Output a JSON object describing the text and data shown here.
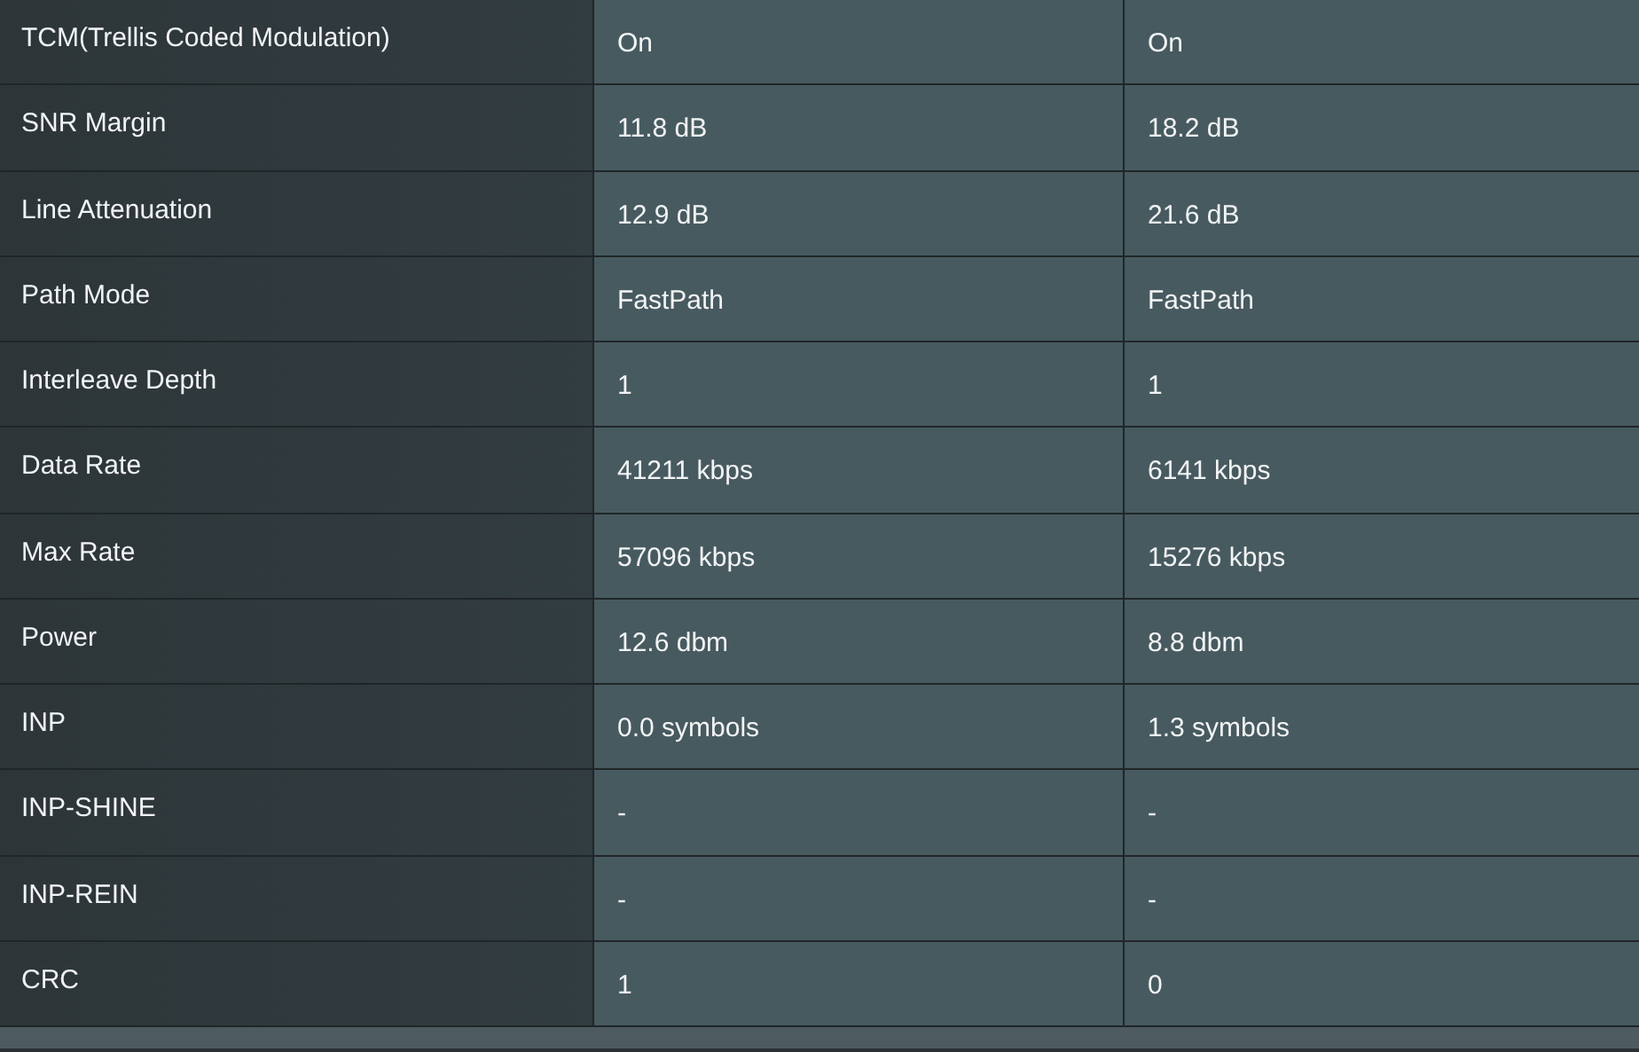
{
  "rows": [
    {
      "label": "TCM(Trellis Coded Modulation)",
      "values": [
        "On",
        "On"
      ]
    },
    {
      "label": "SNR Margin",
      "values": [
        "11.8 dB",
        "18.2 dB"
      ]
    },
    {
      "label": "Line Attenuation",
      "values": [
        "12.9 dB",
        "21.6 dB"
      ]
    },
    {
      "label": "Path Mode",
      "values": [
        "FastPath",
        "FastPath"
      ]
    },
    {
      "label": "Interleave Depth",
      "values": [
        "1",
        "1"
      ]
    },
    {
      "label": "Data Rate",
      "values": [
        "41211 kbps",
        "6141 kbps"
      ]
    },
    {
      "label": "Max Rate",
      "values": [
        "57096 kbps",
        "15276 kbps"
      ]
    },
    {
      "label": "Power",
      "values": [
        "12.6 dbm",
        "8.8 dbm"
      ]
    },
    {
      "label": "INP",
      "values": [
        "0.0 symbols",
        "1.3 symbols"
      ]
    },
    {
      "label": "INP-SHINE",
      "values": [
        "-",
        "-"
      ]
    },
    {
      "label": "INP-REIN",
      "values": [
        "-",
        "-"
      ]
    },
    {
      "label": "CRC",
      "values": [
        "1",
        "0"
      ]
    }
  ]
}
